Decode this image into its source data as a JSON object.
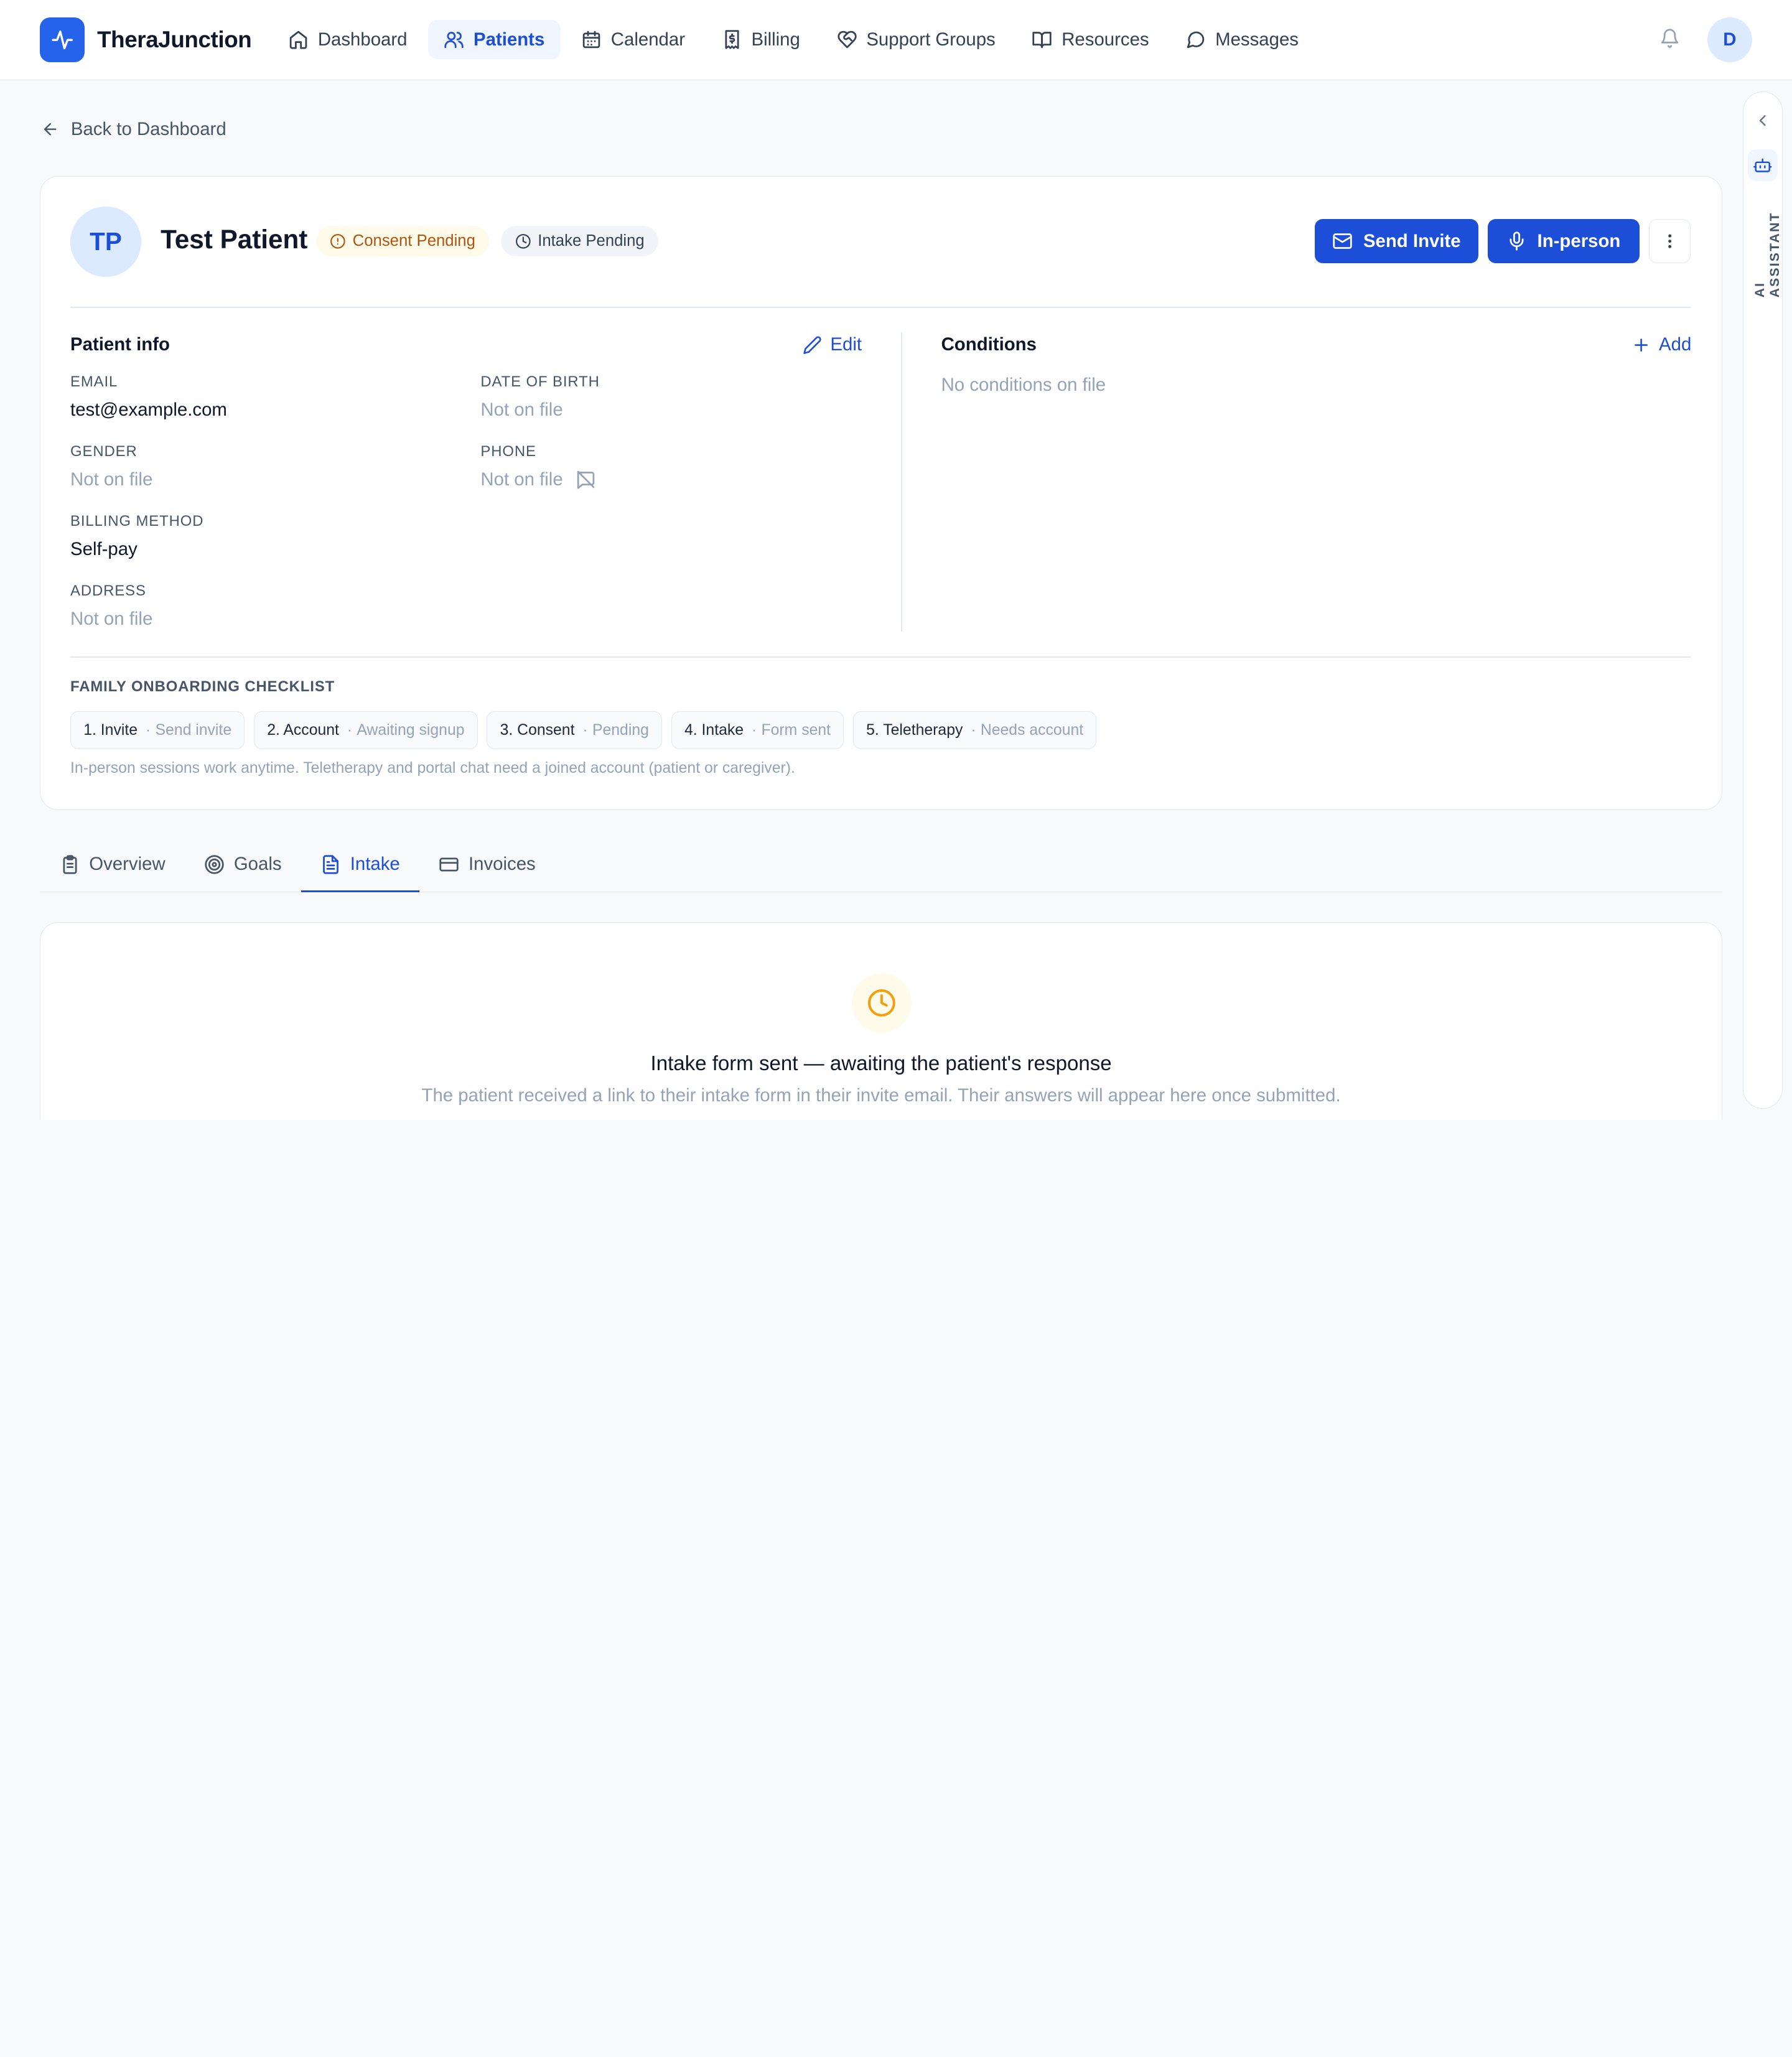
{
  "app": {
    "name": "TheraJunction"
  },
  "nav": {
    "items": [
      {
        "label": "Dashboard",
        "icon": "home-icon"
      },
      {
        "label": "Patients",
        "icon": "users-icon",
        "active": true
      },
      {
        "label": "Calendar",
        "icon": "calendar-icon"
      },
      {
        "label": "Billing",
        "icon": "receipt-icon"
      },
      {
        "label": "Support Groups",
        "icon": "heart-handshake-icon"
      },
      {
        "label": "Resources",
        "icon": "book-open-icon"
      },
      {
        "label": "Messages",
        "icon": "message-circle-icon"
      }
    ],
    "user_initial": "D"
  },
  "back_link": "Back to Dashboard",
  "patient": {
    "initials": "TP",
    "name": "Test Patient",
    "badges": {
      "consent": "Consent Pending",
      "intake": "Intake Pending"
    },
    "actions": {
      "send_invite": "Send Invite",
      "in_person": "In-person"
    }
  },
  "info": {
    "title": "Patient info",
    "edit_label": "Edit",
    "fields": {
      "email": {
        "label": "EMAIL",
        "value": "test@example.com"
      },
      "dob": {
        "label": "DATE OF BIRTH",
        "value": "Not on file"
      },
      "gender": {
        "label": "GENDER",
        "value": "Not on file"
      },
      "phone": {
        "label": "PHONE",
        "value": "Not on file"
      },
      "billing": {
        "label": "BILLING METHOD",
        "value": "Self-pay"
      },
      "address": {
        "label": "ADDRESS",
        "value": "Not on file"
      }
    }
  },
  "conditions": {
    "title": "Conditions",
    "add_label": "Add",
    "empty": "No conditions on file"
  },
  "checklist": {
    "title": "FAMILY ONBOARDING CHECKLIST",
    "steps": [
      {
        "label": "1. Invite",
        "status": "Send invite"
      },
      {
        "label": "2. Account",
        "status": "Awaiting signup"
      },
      {
        "label": "3. Consent",
        "status": "Pending"
      },
      {
        "label": "4. Intake",
        "status": "Form sent"
      },
      {
        "label": "5. Teletherapy",
        "status": "Needs account"
      }
    ],
    "note": "In-person sessions work anytime. Teletherapy and portal chat need a joined account (patient or caregiver)."
  },
  "tabs": [
    {
      "label": "Overview",
      "icon": "clipboard-icon"
    },
    {
      "label": "Goals",
      "icon": "target-icon"
    },
    {
      "label": "Intake",
      "icon": "file-text-icon",
      "active": true
    },
    {
      "label": "Invoices",
      "icon": "credit-card-icon"
    }
  ],
  "intake_panel": {
    "title": "Intake form sent — awaiting the patient's response",
    "subtitle": "The patient received a link to their intake form in their invite email. Their answers will appear here once submitted."
  },
  "assistant": {
    "label": "AI ASSISTANT"
  },
  "colors": {
    "accent": "#1d4ed8",
    "warning": "#b45309",
    "muted": "#94a3b8"
  }
}
